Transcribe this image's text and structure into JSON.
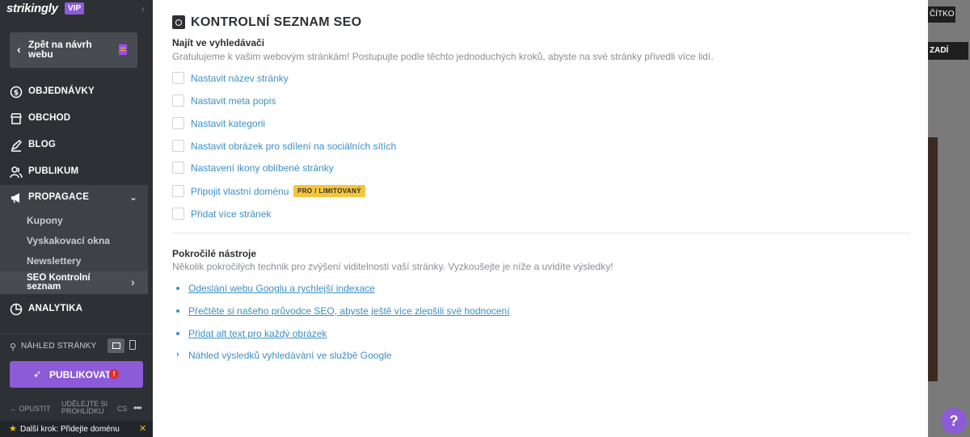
{
  "sidebar": {
    "logo": "strikingly",
    "vip": "VIP",
    "back_label": "Zpět na návrh webu",
    "nav": [
      {
        "label": "OBJEDNÁVKY",
        "icon": "dollar-circle-icon"
      },
      {
        "label": "OBCHOD",
        "icon": "store-icon"
      },
      {
        "label": "BLOG",
        "icon": "pen-icon"
      },
      {
        "label": "PUBLIKUM",
        "icon": "people-icon"
      },
      {
        "label": "PROPAGACE",
        "icon": "megaphone-icon"
      },
      {
        "label": "ANALYTIKA",
        "icon": "pie-chart-icon"
      }
    ],
    "sub_items": [
      "Kupony",
      "Vyskakovací okna",
      "Newslettery"
    ],
    "active_sub": "SEO Kontrolní seznam",
    "preview_label": "NÁHLED STRÁNKY",
    "publish_label": "PUBLIKOVAT",
    "publish_alert": "!",
    "bottom": {
      "opustit": "OPUSTIT",
      "udelejte": "UDĚLEJTE SI PROHLÍDKU",
      "lang": "CS",
      "more": "•••"
    },
    "next_step": "Další krok: Přidejte doménu"
  },
  "background": {
    "btn1": "ČÍTKO",
    "btn2": "ZADÍ",
    "help": "?"
  },
  "panel": {
    "title": "KONTROLNÍ SEZNAM SEO",
    "find_heading": "Najít ve vyhledávači",
    "find_desc": "Gratulujeme k vašim webovým stránkám! Postupujte podle těchto jednoduchých kroků, abyste na své stránky přivedli více lidí.",
    "checklist": [
      "Nastavit název stránky",
      "Nastavit meta popis",
      "Nastavit kategorii",
      "Nastavit obrázek pro sdílení na sociálních sítích",
      "Nastavení ikony oblíbené stránky",
      "Připojit vlastní doménu",
      "Přidat více stránek"
    ],
    "pro_badge": "PRO / LIMITOVANÝ",
    "advanced_heading": "Pokročilé nástroje",
    "advanced_desc": "Několik pokročilých technik pro zvýšení viditelnosti vaší stránky. Vyzkoušejte je níže a uvidíte výsledky!",
    "links": [
      "Odeslání webu Googlu a rychlejší indexace",
      "Přečtěte si našeho průvodce SEO, abyste ještě více zlepšili své hodnocení",
      "Přidat alt text pro každý obrázek"
    ],
    "google_preview": "Náhled výsledků vyhledávání ve službě Google"
  },
  "colors": {
    "sidebar": "#2d3034",
    "accent": "#8c5bd8",
    "link": "#3d8fc6",
    "badge": "#f3c63b"
  }
}
